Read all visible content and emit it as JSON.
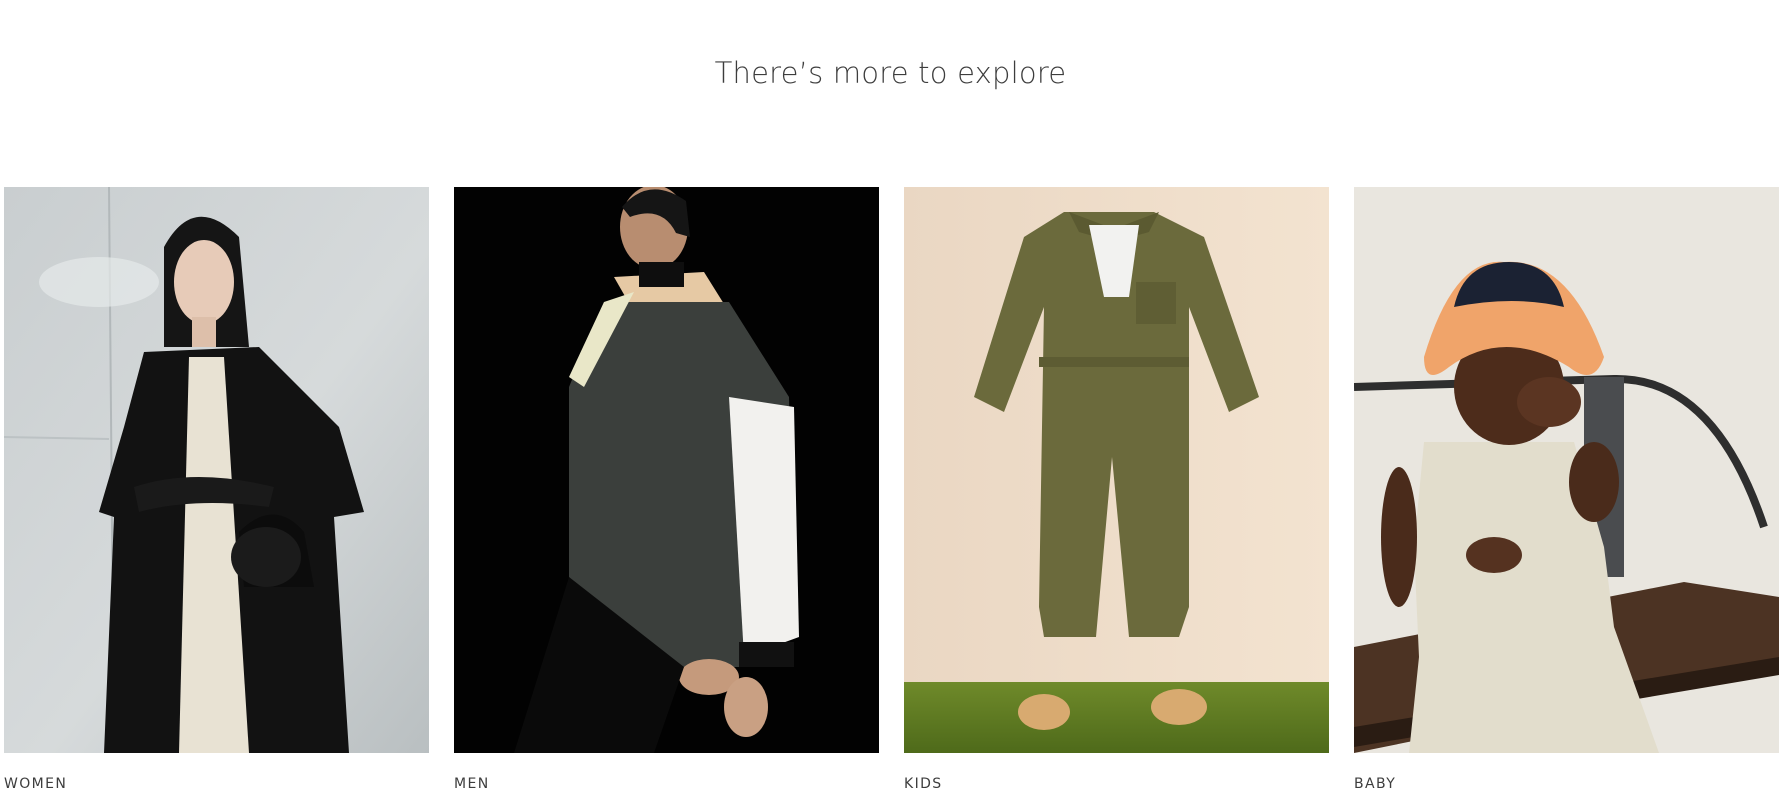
{
  "section": {
    "title": "There’s more to explore"
  },
  "categories": [
    {
      "label": "WOMEN",
      "image": "women-model-black-coat-photo"
    },
    {
      "label": "MEN",
      "image": "men-model-colorblock-jacket-photo"
    },
    {
      "label": "KIDS",
      "image": "kids-olive-jumpsuit-photo"
    },
    {
      "label": "BABY",
      "image": "baby-bucket-hat-linen-romper-photo"
    }
  ],
  "colors": {
    "text": "#3d3d3d",
    "background": "#ffffff"
  }
}
